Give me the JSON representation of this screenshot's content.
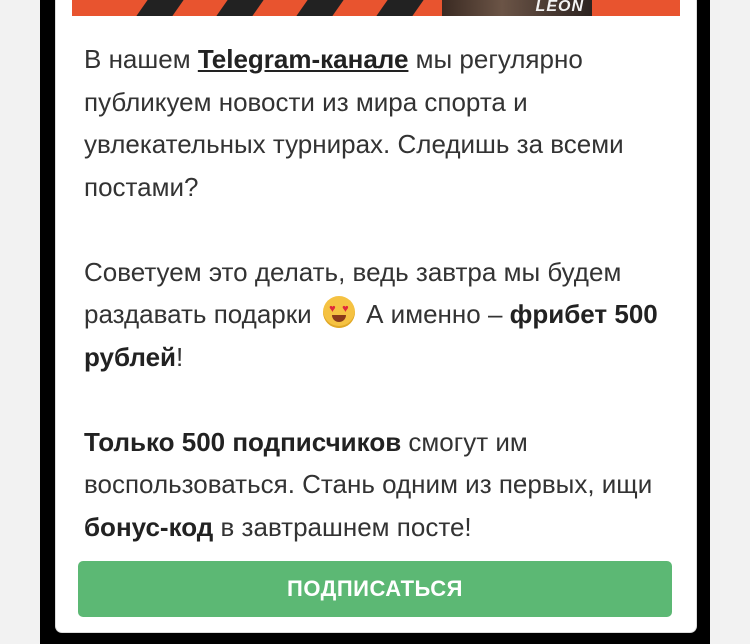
{
  "banner": {
    "logo_text": "LEON"
  },
  "message": {
    "p1": {
      "before": "В нашем ",
      "link": "Telegram-канале",
      "after": " мы регулярно публикуем новости из мира спорта и увлекательных турнирах. Следишь за всеми постами?"
    },
    "p2": {
      "before": "Советуем это делать, ведь завтра мы будем раздавать подарки",
      "emoji": "heart-eyes-emoji",
      "middle": " А именно – ",
      "bold": "фрибет 500 рублей",
      "after": "!"
    },
    "p3": {
      "bold1": "Только 500 подписчиков",
      "middle": " смогут им воспользоваться. Стань одним из первых, ищи ",
      "bold2": "бонус-код",
      "after": " в завтрашнем посте!"
    }
  },
  "cta": {
    "label": "ПОДПИСАТЬСЯ",
    "color": "#5cb874"
  },
  "colors": {
    "banner_accent": "#e8542f",
    "frame": "#000000",
    "page_bg": "#f2f2f2"
  }
}
